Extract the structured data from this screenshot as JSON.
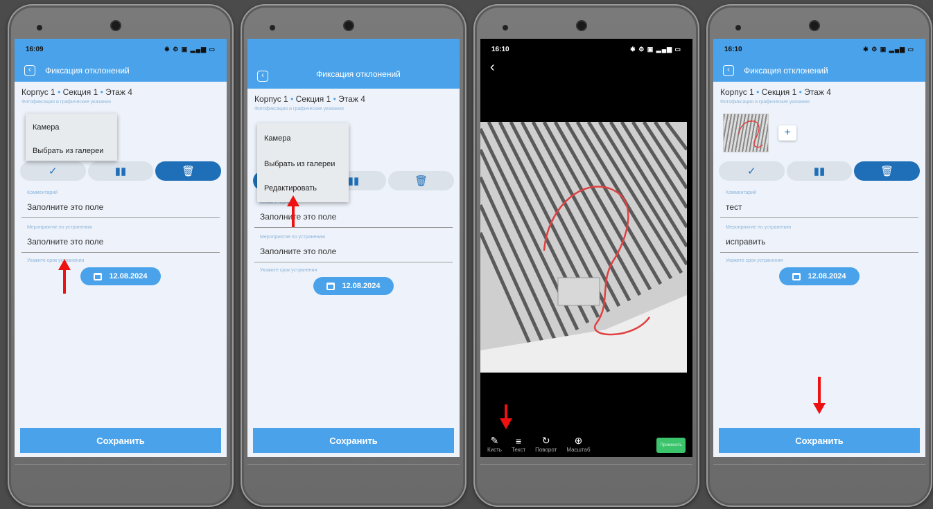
{
  "screens": [
    {
      "status_time": "16:09",
      "title": "Фиксация отклонений",
      "breadcrumb": {
        "building": "Корпус 1",
        "section": "Секция 1",
        "floor": "Этаж 4",
        "separator": "•"
      },
      "photo_label": "Фотофиксация и графические указания",
      "menu": [
        "Камера",
        "Выбрать из галереи"
      ],
      "comment_label": "Комментарий",
      "comment_value": "Заполните это поле",
      "measure_label": "Мероприятие по устранению",
      "measure_value": "Заполните это поле",
      "deadline_label": "Укажите срок устранения",
      "date": "12.08.2024",
      "save": "Сохранить"
    },
    {
      "title": "Фиксация отклонений",
      "breadcrumb": {
        "building": "Корпус 1",
        "section": "Секция 1",
        "floor": "Этаж 4",
        "separator": "•"
      },
      "photo_label": "Фотофиксация и графические указания",
      "menu": [
        "Камера",
        "Выбрать из галереи",
        "Редактировать"
      ],
      "comment_label": "Комментарий",
      "comment_value": "Заполните это поле",
      "measure_label": "Мероприятие по устранению",
      "measure_value": "Заполните это поле",
      "deadline_label": "Укажите срок устранения",
      "date": "12.08.2024",
      "save": "Сохранить"
    },
    {
      "status_time": "16:10",
      "tools": [
        {
          "label": "Кисть",
          "icon": "brush-icon"
        },
        {
          "label": "Текст",
          "icon": "text-icon"
        },
        {
          "label": "Поворот",
          "icon": "rotate-icon"
        },
        {
          "label": "Масштаб",
          "icon": "zoom-icon"
        }
      ],
      "apply": "Применить"
    },
    {
      "status_time": "16:10",
      "title": "Фиксация отклонений",
      "breadcrumb": {
        "building": "Корпус 1",
        "section": "Секция 1",
        "floor": "Этаж 4",
        "separator": "•"
      },
      "photo_label": "Фотофиксация и графические указания",
      "comment_label": "Комментарий",
      "comment_value": "тест",
      "measure_label": "Мероприятие по устранению",
      "measure_value": "исправить",
      "deadline_label": "Укажите срок устранения",
      "date": "12.08.2024",
      "save": "Сохранить"
    }
  ],
  "colors": {
    "accent": "#4aa3ea",
    "primary_dark": "#1e6fb8",
    "annotation": "#e11111",
    "draw_stroke": "#e04040"
  }
}
